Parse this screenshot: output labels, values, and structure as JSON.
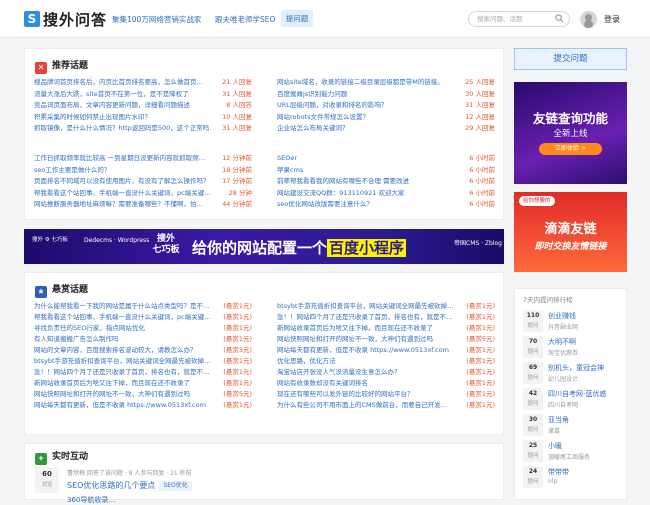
{
  "header": {
    "logo_letter": "S",
    "logo_text": "搜外问答",
    "slogan": "聚集100万网络营销实战家",
    "nav_follow": "跟夫唯老师学SEO",
    "nav_active": "提问题",
    "search_placeholder": "搜索问题、话题",
    "login": "登录"
  },
  "recommend": {
    "title": "推荐话题",
    "left_group1": [
      {
        "t": "搜品牌词首页排名后，内页比首页排名要高，怎么做首页…",
        "m": "21 人回复"
      },
      {
        "t": "流量大涨后大跌，site首页不在第一位，是不是降权了",
        "m": "31 人回复"
      },
      {
        "t": "竞品词页面布局，文章内容更新问题，详细看问题描述",
        "m": "8 人回答"
      },
      {
        "t": "积累采集的时候如何禁止出现图片水印？",
        "m": "10 人回复"
      },
      {
        "t": "抓取镜像，是什么什么情况？http返回码是500，这个正常吗…",
        "m": "31 人回复"
      }
    ],
    "right_group1": [
      {
        "t": "网站site域名，收录的链接二级目录层级都是带M的链接。",
        "m": "25 人回复"
      },
      {
        "t": "百度蜘蛛js识别能力问题",
        "m": "30 人回复"
      },
      {
        "t": "URL层级问题，对收录和排名的影响？",
        "m": "31 人回复"
      },
      {
        "t": "网站robots文件常规怎么设置？",
        "m": "12 人回复"
      },
      {
        "t": "企业站怎么布局关键词？",
        "m": "29 人回复"
      }
    ],
    "left_group2": [
      {
        "t": "工作日抓取频率就比较高 一到星期日没更新内容就抓取频…",
        "m": "12 分钟前"
      },
      {
        "t": "seo工作主要是做什么的？",
        "m": "18 分钟前"
      },
      {
        "t": "页面排名不同域可以没有使用图片，有没有了解怎么操作吗？",
        "m": "17 分钟前"
      },
      {
        "t": "帮我看看这个站回事，手机端一直没什么关键词，pc端关键…",
        "m": "28 分钟"
      },
      {
        "t": "网站推断服务器地址麻烦嘛？需要准备哪些？不懂啊，怕…",
        "m": "44 分钟前"
      }
    ],
    "right_group2": [
      {
        "t": "SEOer",
        "m": "6 小时前"
      },
      {
        "t": "苹果cms",
        "m": "6 小时前"
      },
      {
        "t": "前辈帮我看看我的网站有哪些不合理 需要改进",
        "m": "6 小时前"
      },
      {
        "t": "网站建设交流QQ群：913110921 欢迎大家",
        "m": "6 小时前"
      },
      {
        "t": "seo优化网站改版需要注意什么？",
        "m": "6 小时前"
      }
    ]
  },
  "banner": {
    "logo1": "搜外 ⚙ 七巧板",
    "logo2": "Dedecms · Wordpress",
    "icon_text": "搜外 七巧板",
    "main_prefix": "给你的网站配置一个",
    "main_highlight": "百度小程序",
    "logo3": "帝国CMS · Zblog"
  },
  "bounty": {
    "title": "悬赏话题",
    "left": [
      {
        "t": "为什么能帮我看一下我的网站是属于什么站点类型吗？是不…",
        "m": "(悬赏1元)"
      },
      {
        "t": "帮我看看这个站回事，手机端一直没什么关键词，pc端关键…",
        "m": "(悬赏1元)"
      },
      {
        "t": "寻找负责任的SEO行家，指点网站优化",
        "m": "(悬赏1元)"
      },
      {
        "t": "有人知道搬搬广告怎么制作吗",
        "m": "(悬赏1元)"
      },
      {
        "t": "网站的文章内容，百度搜索排名波动较大，请教怎么办？",
        "m": "(悬赏3元)"
      },
      {
        "t": "btsybt手游充值折扣查询平台，网站关键词全网最先被砍掉…",
        "m": "(悬赏1元)"
      },
      {
        "t": "急！！网站四个月了还是只收录了首页，排名也有，就是不…",
        "m": "(悬赏1元)"
      },
      {
        "t": "新网站收录首页后为啥又往下掉，而且现在还不收录了",
        "m": "(悬赏1元)"
      },
      {
        "t": "网站快照网址和打开的网址不一致，大神们有遇到过吗",
        "m": "(悬赏5元)"
      },
      {
        "t": "网站每天都有更新，但是不收录 https://www.0513xf.com",
        "m": "(悬赏1元)"
      }
    ],
    "right": [
      {
        "t": "btsybt手游充值折扣查询平台，网站关键词全网最先被砍掉…",
        "m": "(悬赏1元)"
      },
      {
        "t": "急！！网站四个月了还是只收录了首页，排名也有，就是不…",
        "m": "(悬赏1元)"
      },
      {
        "t": "新网站收录首页后为啥又往下掉，而且现在还不收录了",
        "m": "(悬赏1元)"
      },
      {
        "t": "网站快照网址和打开的网址不一致，大神们有遇到过吗",
        "m": "(悬赏5元)"
      },
      {
        "t": "网站每天都有更新，但是不收录 https://www.0513xf.com",
        "m": "(悬赏1元)"
      },
      {
        "t": "优化思路，优化方法",
        "m": "(悬赏1元)"
      },
      {
        "t": "淘宝站店开张没人气没流量没生意怎么办？",
        "m": "(悬赏1元)"
      },
      {
        "t": "网站有收录数却没有关键词排名",
        "m": "(悬赏1元)"
      },
      {
        "t": "现在还有哪些可以发外链的比较好的网站平台？",
        "m": "(悬赏1元)"
      },
      {
        "t": "为什么有些公司不用市面上的CMS做前台，而要自己开发…",
        "m": "(悬赏1元)"
      }
    ]
  },
  "live": {
    "title": "实时互动",
    "votes": "60",
    "votes_label": "浏览",
    "meta": "曹然梅 回答了该问题 · 8 人参与回复 · 21 秒前",
    "question": "SEO优化思路的几个要点",
    "tag": "SEO优化",
    "question2": "360导航收录…"
  },
  "sidebar": {
    "ask_button": "提交问题",
    "ad1": {
      "line1": "友链查询功能",
      "line2": "全新上线",
      "btn": "立即体验 >"
    },
    "ad2": {
      "tag": "给你想要的",
      "line1": "滴滴友链",
      "line2": "即时交换友情链接"
    },
    "rank_title": "7天内提问排行榜",
    "rank_label": "提问",
    "rank": [
      {
        "n": "110",
        "name": "创业赚钱",
        "desc": "抖音副业网"
      },
      {
        "n": "70",
        "name": "大明不啊",
        "desc": "淘宝优惠券"
      },
      {
        "n": "69",
        "name": "别机头，童冠会神",
        "desc": "幼儿园设计"
      },
      {
        "n": "42",
        "name": "四川自考网-蓝优惑",
        "desc": "四川自考网"
      },
      {
        "n": "30",
        "name": "亚当角",
        "desc": "诸葛"
      },
      {
        "n": "25",
        "name": "小暖",
        "desc": "頂暖尾工商服务"
      },
      {
        "n": "24",
        "name": "带带带",
        "desc": "nlp"
      }
    ]
  }
}
